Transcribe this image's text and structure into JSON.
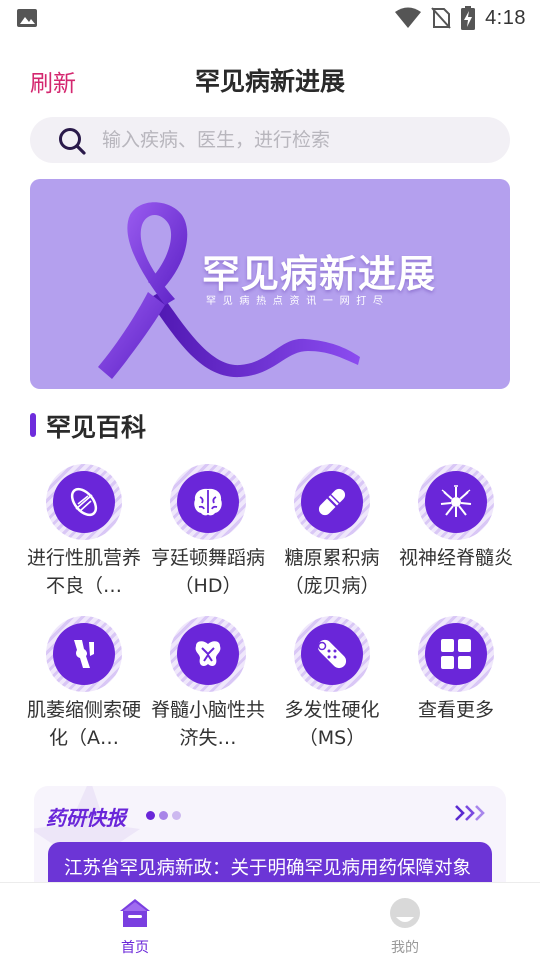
{
  "status_bar": {
    "time": "4:18",
    "icons": [
      "gallery-icon",
      "wifi-icon",
      "no-sim-icon",
      "battery-charging-icon"
    ]
  },
  "header": {
    "refresh_label": "刷新",
    "title": "罕见病新进展"
  },
  "search": {
    "placeholder": "输入疾病、医生，进行检索",
    "value": "",
    "icon": "search-icon"
  },
  "banner": {
    "title": "罕见病新进展",
    "subtitle": "罕见病热点资讯一网打尽",
    "background_color": "#b4a0ee",
    "ribbon_color": "#7b3fe4"
  },
  "section": {
    "title": "罕见百科",
    "accent_color": "#6e2cdc"
  },
  "encyclopedia": [
    {
      "label": "进行性肌营养不良（…",
      "icon": "muscle-icon"
    },
    {
      "label": "亨廷顿舞蹈病（HD）",
      "icon": "brain-icon"
    },
    {
      "label": "糖原累积病（庞贝病）",
      "icon": "capsule-icon"
    },
    {
      "label": "视神经脊髓炎",
      "icon": "neuron-icon"
    },
    {
      "label": "肌萎缩侧索硬化（A…",
      "icon": "joint-icon"
    },
    {
      "label": "脊髓小脑性共济失…",
      "icon": "spine-icon"
    },
    {
      "label": "多发性硬化（MS）",
      "icon": "bandage-icon"
    },
    {
      "label": "查看更多",
      "icon": "grid-more-icon"
    }
  ],
  "news": {
    "title": "药研快报",
    "more_icon": "triple-chevron-icon",
    "items": [
      {
        "text": "江苏省罕见病新政：关于明确罕见病用药保障对象"
      }
    ]
  },
  "tabbar": {
    "tabs": [
      {
        "label": "首页",
        "icon": "home-icon",
        "active": true
      },
      {
        "label": "我的",
        "icon": "profile-icon",
        "active": false
      }
    ],
    "active_color": "#6a26d9",
    "inactive_color": "#999999"
  }
}
